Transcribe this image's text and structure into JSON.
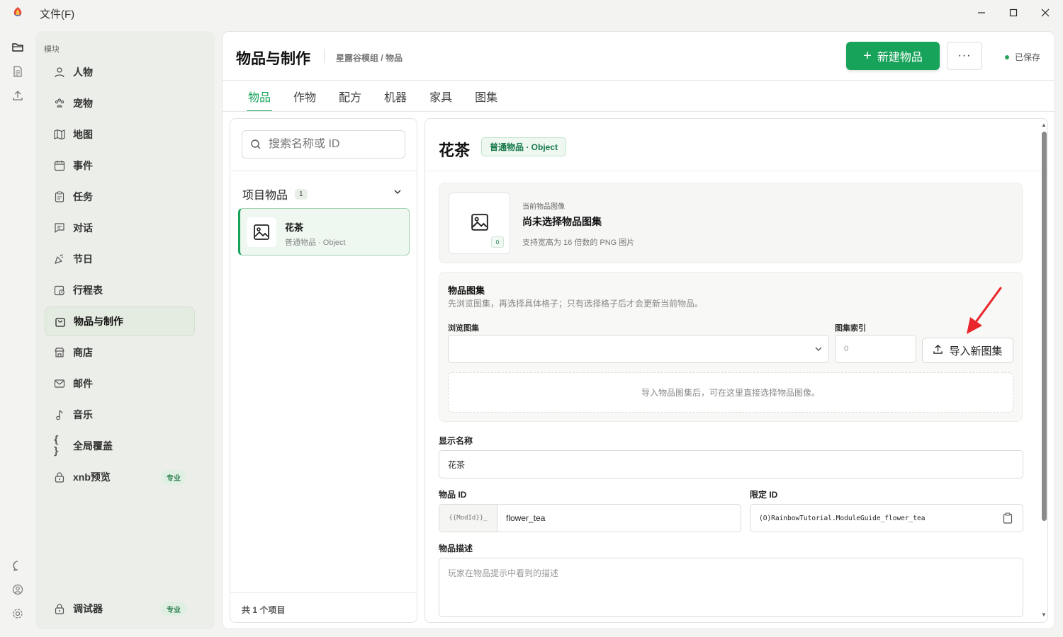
{
  "titlebar": {
    "menu_file": "文件(F)"
  },
  "sidebar": {
    "section": "模块",
    "items": [
      {
        "label": "人物",
        "icon": "person-icon"
      },
      {
        "label": "宠物",
        "icon": "paw-icon"
      },
      {
        "label": "地图",
        "icon": "map-icon"
      },
      {
        "label": "事件",
        "icon": "calendar-icon"
      },
      {
        "label": "任务",
        "icon": "clipboard-icon"
      },
      {
        "label": "对话",
        "icon": "message-icon"
      },
      {
        "label": "节日",
        "icon": "party-icon"
      },
      {
        "label": "行程表",
        "icon": "schedule-icon"
      },
      {
        "label": "物品与制作",
        "icon": "bag-icon"
      },
      {
        "label": "商店",
        "icon": "store-icon"
      },
      {
        "label": "邮件",
        "icon": "mail-icon"
      },
      {
        "label": "音乐",
        "icon": "music-icon"
      },
      {
        "label": "全局覆盖",
        "icon": "braces-icon"
      },
      {
        "label": "xnb预览",
        "icon": "lock-icon",
        "badge": "专业"
      }
    ],
    "debugger": {
      "label": "调试器",
      "badge": "专业"
    }
  },
  "header": {
    "title": "物品与制作",
    "breadcrumb": "星露谷模组 / 物品",
    "new_button": "新建物品",
    "more": "···",
    "status": "已保存"
  },
  "tabs": [
    "物品",
    "作物",
    "配方",
    "机器",
    "家具",
    "图集"
  ],
  "list": {
    "search_placeholder": "搜索名称或 ID",
    "group_title": "项目物品",
    "group_count": "1",
    "items": [
      {
        "name": "花茶",
        "sub": "普通物品 · Object"
      }
    ],
    "footer": "共 1 个项目"
  },
  "detail": {
    "title": "花茶",
    "badge": "普通物品 · Object",
    "image": {
      "label": "当前物品图像",
      "title": "尚未选择物品图集",
      "hint": "支持宽高为 16 倍数的 PNG 图片",
      "mini": "0"
    },
    "atlas": {
      "title": "物品图集",
      "desc": "先浏览图集，再选择具体格子；只有选择格子后才会更新当前物品。",
      "browse_label": "浏览图集",
      "index_label": "图集索引",
      "index_value": "0",
      "import_button": "导入新图集",
      "empty_hint": "导入物品图集后，可在这里直接选择物品图像。"
    },
    "display_name_label": "显示名称",
    "display_name_value": "花茶",
    "item_id_label": "物品 ID",
    "item_id_prefix": "{{ModId}}_",
    "item_id_value": "flower_tea",
    "qualified_id_label": "限定 ID",
    "qualified_id_value": "(O)RainbowTutorial.ModuleGuide_flower_tea",
    "description_label": "物品描述",
    "description_placeholder": "玩家在物品提示中看到的描述"
  },
  "colors": {
    "accent": "#17a35a",
    "annotation_arrow": "#e8262b"
  }
}
